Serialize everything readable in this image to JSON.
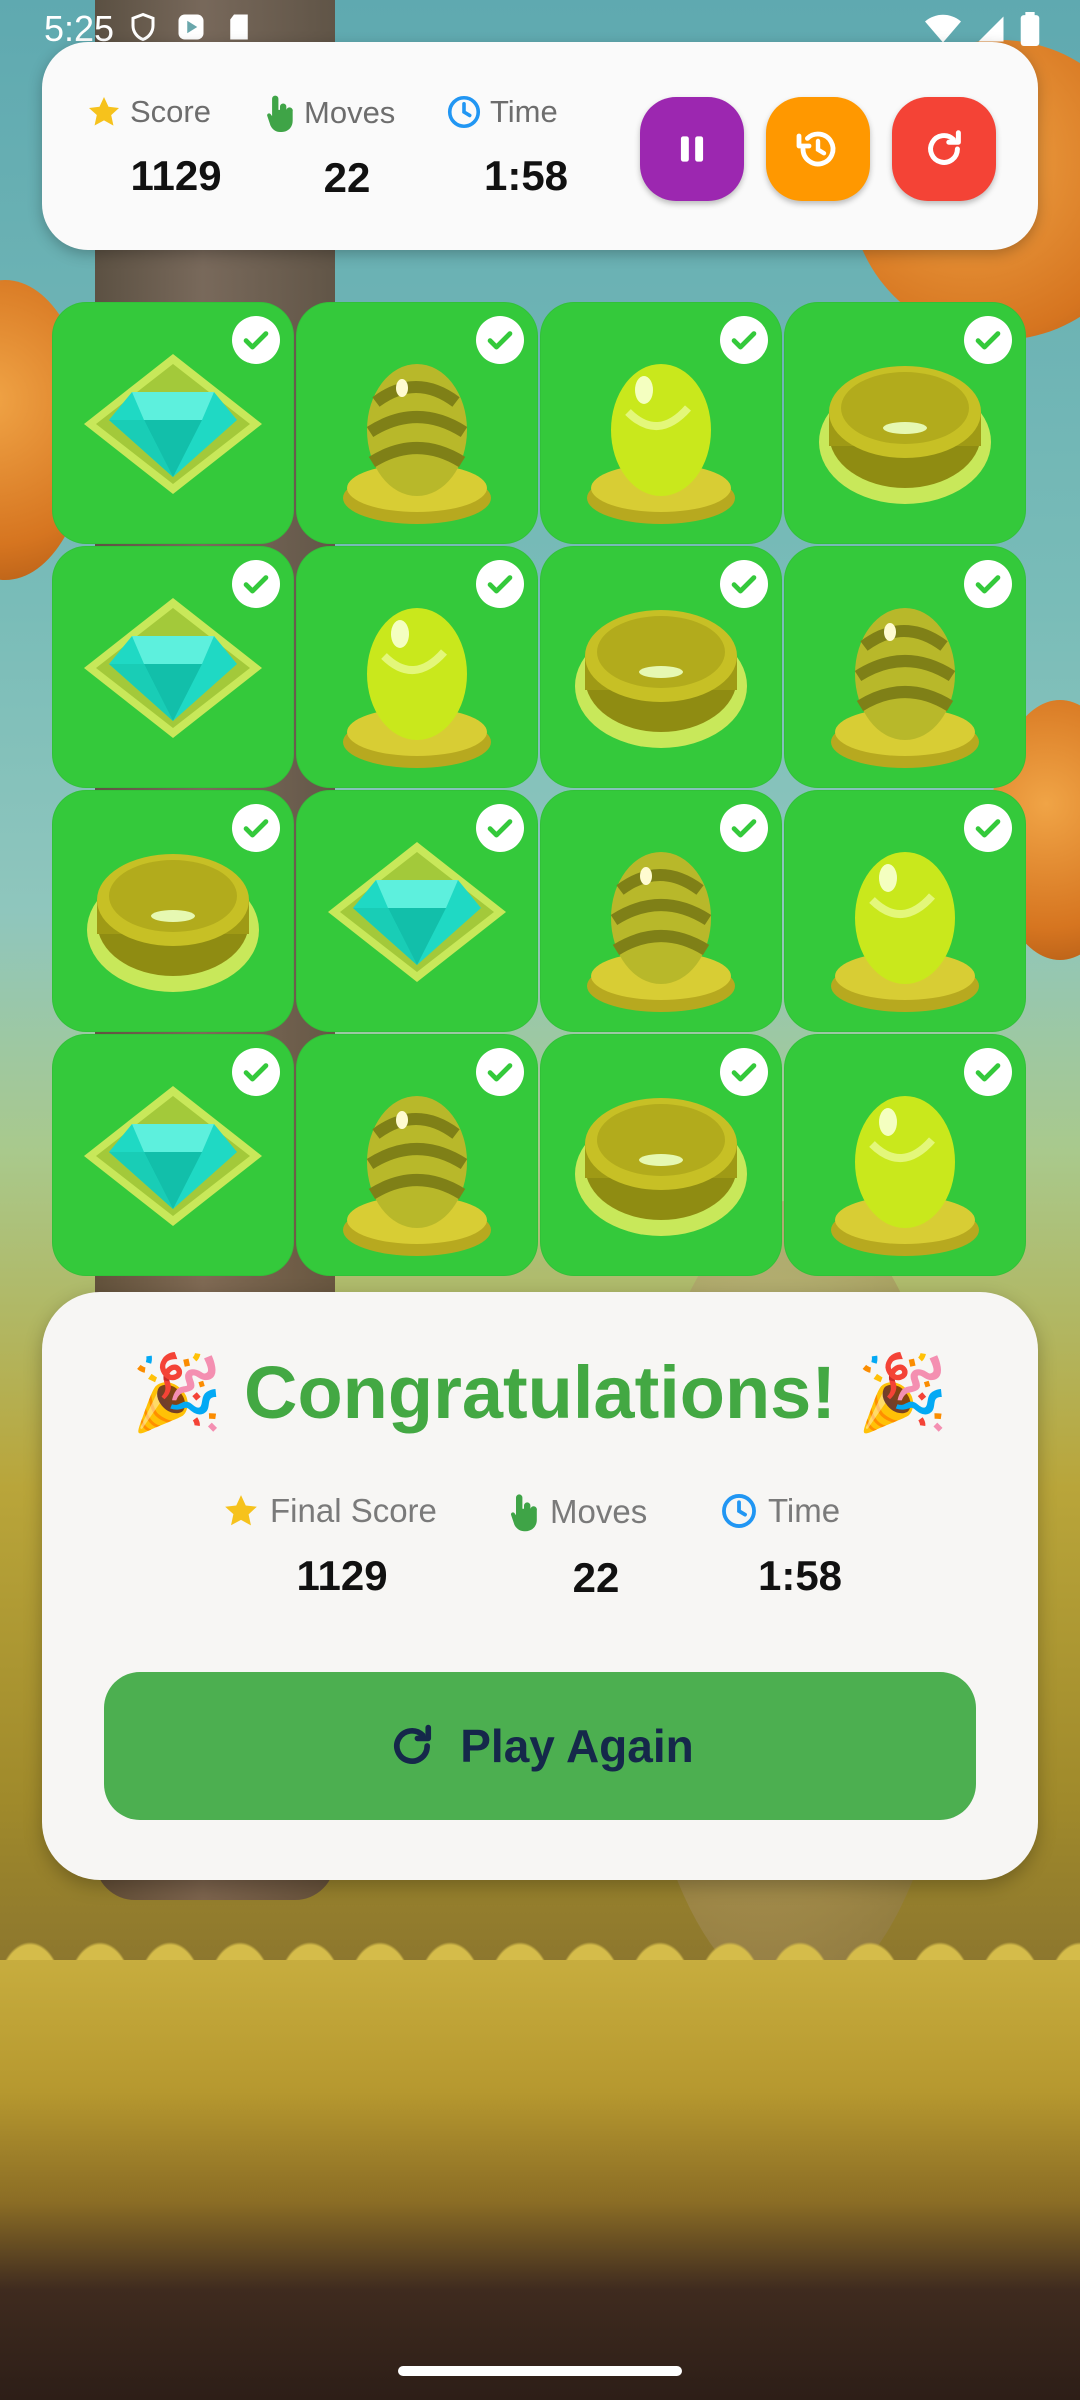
{
  "status_bar": {
    "time": "5:25"
  },
  "hud": {
    "score": {
      "label": "Score",
      "value": "1129",
      "icon": "star-icon"
    },
    "moves": {
      "label": "Moves",
      "value": "22",
      "icon": "tap-hand-icon"
    },
    "time": {
      "label": "Time",
      "value": "1:58",
      "icon": "clock-icon"
    },
    "buttons": [
      {
        "name": "pause-button",
        "icon": "pause-icon",
        "color": "#9c27b0"
      },
      {
        "name": "history-button",
        "icon": "history-icon",
        "color": "#ff9800"
      },
      {
        "name": "restart-button",
        "icon": "refresh-icon",
        "color": "#f44336"
      }
    ]
  },
  "board": {
    "tile_color": "#34c93b",
    "rows": [
      [
        "diamond",
        "striped-egg",
        "plain-egg",
        "coin"
      ],
      [
        "diamond",
        "plain-egg",
        "coin",
        "striped-egg"
      ],
      [
        "coin",
        "diamond",
        "striped-egg",
        "plain-egg"
      ],
      [
        "diamond",
        "striped-egg",
        "coin",
        "plain-egg"
      ]
    ],
    "matched": true
  },
  "result": {
    "title": "Congratulations!",
    "emoji": "🎉",
    "final_score": {
      "label": "Final Score",
      "value": "1129"
    },
    "moves": {
      "label": "Moves",
      "value": "22"
    },
    "time": {
      "label": "Time",
      "value": "1:58"
    },
    "play_again_label": "Play Again",
    "accent": "#4caf50"
  }
}
